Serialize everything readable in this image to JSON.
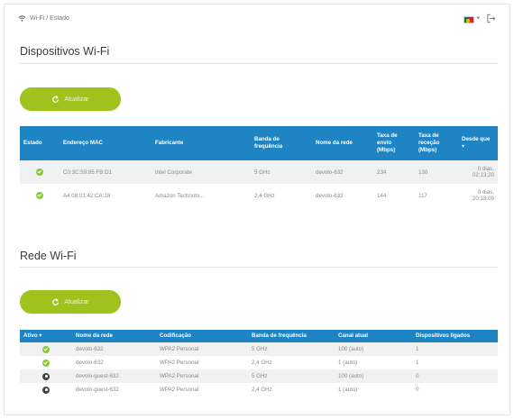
{
  "breadcrumb": "Wi-Fi / Estado",
  "devices_section": {
    "title": "Dispositivos Wi-Fi",
    "refresh_label": "Atualizar",
    "columns": [
      "Estado",
      "Endereço MAC",
      "Fabricante",
      "Banda de frequência",
      "Nome da rede",
      "Taxa de envio (Mbps)",
      "Taxa de receção (Mbps)",
      "Desde que"
    ],
    "rows": [
      {
        "status": "connected",
        "mac": "C0:3C:59:85:FB:D1",
        "vendor": "Intel Corporate",
        "band": "5 GHz",
        "ssid": "devolo-632",
        "tx": "234",
        "rx": "130",
        "since": "0 dias, 02:13:20"
      },
      {
        "status": "connected",
        "mac": "A4:08:01:42:CA:18",
        "vendor": "Amazon Technolo...",
        "band": "2,4 GHz",
        "ssid": "devolo-632",
        "tx": "144",
        "rx": "117",
        "since": "0 dias, 20:18:09"
      }
    ]
  },
  "networks_section": {
    "title": "Rede Wi-Fi",
    "refresh_label": "Atualizar",
    "columns": [
      "Ativo",
      "Nome da rede",
      "Codificação",
      "Banda de frequência",
      "Canal atual",
      "Dispositivos ligados"
    ],
    "rows": [
      {
        "active": "on",
        "ssid": "devolo-632",
        "encryption": "WPA2 Personal",
        "band": "5 GHz",
        "channel": "100 (auto)",
        "devices": "1"
      },
      {
        "active": "on",
        "ssid": "devolo-632",
        "encryption": "WPA2 Personal",
        "band": "2,4 GHz",
        "channel": "1 (auto)",
        "devices": "1"
      },
      {
        "active": "off",
        "ssid": "devolo-guest-632",
        "encryption": "WPA2 Personal",
        "band": "5 GHz",
        "channel": "100 (auto)",
        "devices": "0"
      },
      {
        "active": "off",
        "ssid": "devolo-guest-632",
        "encryption": "WPA2 Personal",
        "band": "2,4 GHz",
        "channel": "1 (auto)",
        "devices": "0"
      }
    ]
  },
  "icons": {
    "breadcrumb": "wifi-icon",
    "language": "portugal-flag-icon",
    "logout": "logout-icon",
    "refresh": "refresh-icon",
    "status_ok": "check-circle-icon",
    "status_off": "off-circle-icon"
  },
  "colors": {
    "accent_green": "#a0c21c",
    "header_blue": "#1e84c4",
    "status_green": "#8cc63f",
    "status_dark": "#444444"
  }
}
